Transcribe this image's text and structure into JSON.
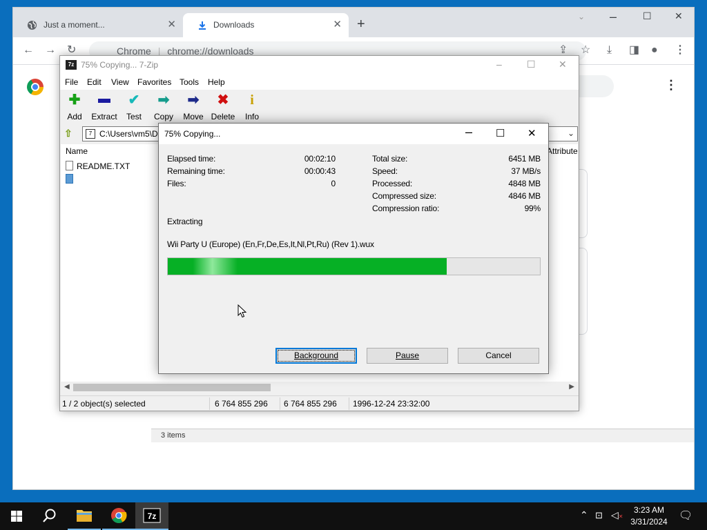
{
  "chrome": {
    "tabs": [
      {
        "label": "Just a moment...",
        "icon": "globe-icon"
      },
      {
        "label": "Downloads",
        "icon": "download-icon"
      }
    ],
    "address_site": "Chrome",
    "address_url": "chrome://downloads",
    "footer_text": "3 items"
  },
  "zip": {
    "title": "75% Copying... 7-Zip",
    "menu": [
      "File",
      "Edit",
      "View",
      "Favorites",
      "Tools",
      "Help"
    ],
    "toolbar": [
      {
        "label": "Add",
        "icon": "plus-icon",
        "color": "#16a016"
      },
      {
        "label": "Extract",
        "icon": "minus-icon",
        "color": "#1a1aa0"
      },
      {
        "label": "Test",
        "icon": "check-icon",
        "color": "#17b9b9"
      },
      {
        "label": "Copy",
        "icon": "copy-arrow-icon",
        "color": "#159c8c"
      },
      {
        "label": "Move",
        "icon": "move-arrow-icon",
        "color": "#1d2a8a"
      },
      {
        "label": "Delete",
        "icon": "delete-x-icon",
        "color": "#d01010"
      },
      {
        "label": "Info",
        "icon": "info-icon",
        "color": "#c8a000"
      }
    ],
    "path": "C:\\Users\\vm5\\D",
    "columns": {
      "name": "Name",
      "attributes": "Attribute"
    },
    "files": [
      {
        "name": "README.TXT"
      },
      {
        "name": ""
      }
    ],
    "status": {
      "selection": "1 / 2 object(s) selected",
      "size": "6 764 855 296",
      "packed": "6 764 855 296",
      "modified": "1996-12-24 23:32:00"
    }
  },
  "dialog": {
    "title": "75% Copying...",
    "elapsed_label": "Elapsed time:",
    "elapsed_value": "00:02:10",
    "remaining_label": "Remaining time:",
    "remaining_value": "00:00:43",
    "files_label": "Files:",
    "files_value": "0",
    "total_label": "Total size:",
    "total_value": "6451 MB",
    "speed_label": "Speed:",
    "speed_value": "37 MB/s",
    "processed_label": "Processed:",
    "processed_value": "4848 MB",
    "compressed_label": "Compressed size:",
    "compressed_value": "4846 MB",
    "ratio_label": "Compression ratio:",
    "ratio_value": "99%",
    "operation": "Extracting",
    "filename": "Wii Party U (Europe) (En,Fr,De,Es,It,Nl,Pt,Ru) (Rev 1).wux",
    "progress_percent": 75,
    "buttons": {
      "background": "Background",
      "pause": "Pause",
      "cancel": "Cancel"
    }
  },
  "taskbar": {
    "time": "3:23 AM",
    "date": "3/31/2024"
  }
}
